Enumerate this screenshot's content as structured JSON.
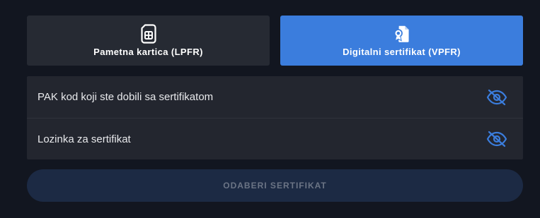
{
  "mode_tabs": [
    {
      "label": "Pametna kartica (LPFR)",
      "icon": "sim-card-icon",
      "active": false
    },
    {
      "label": "Digitalni sertifikat (VPFR)",
      "icon": "certificate-icon",
      "active": true
    }
  ],
  "fields": [
    {
      "placeholder": "PAK kod koji ste dobili sa sertifikatom",
      "icon": "eye-off-icon"
    },
    {
      "placeholder": "Lozinka za sertifikat",
      "icon": "eye-off-icon"
    }
  ],
  "submit_button": {
    "label": "ODABERI SERTIFIKAT",
    "enabled": false
  },
  "colors": {
    "background": "#121620",
    "active_tab": "#3b7ddd",
    "inactive_tab": "#262a33",
    "field_panel": "#23262f",
    "eye_icon": "#3b7ddd",
    "submit_disabled": "#1c2a44"
  }
}
